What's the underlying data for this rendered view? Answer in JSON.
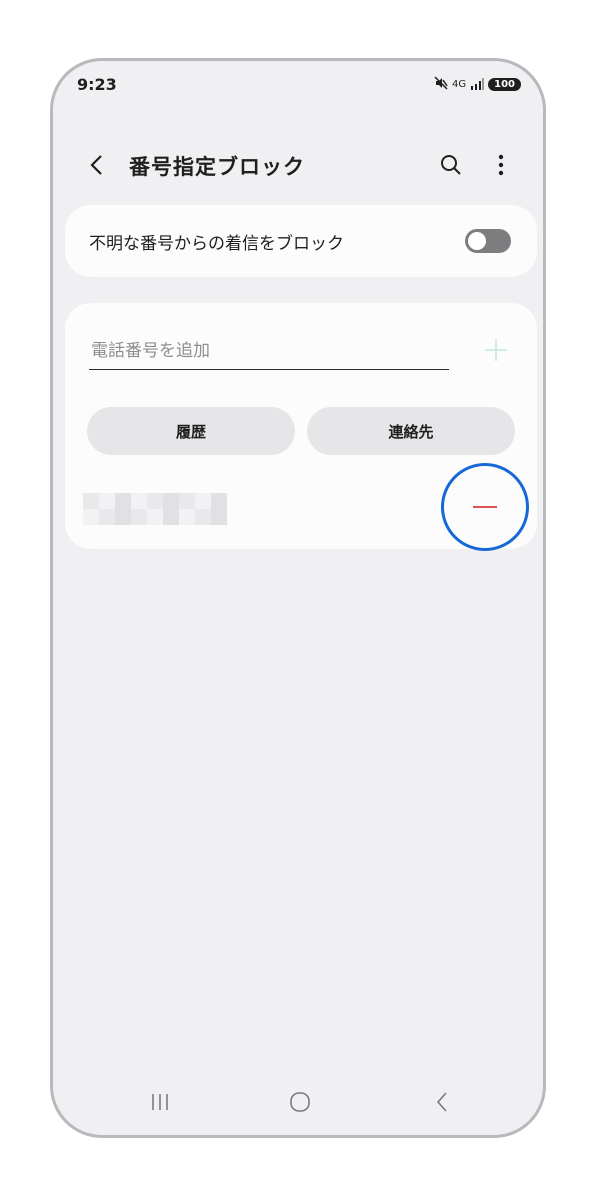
{
  "status_bar": {
    "time": "9:23",
    "network": "4G",
    "battery": "100",
    "icons": [
      "mute-icon",
      "network-4g-icon",
      "signal-icon",
      "battery-icon"
    ]
  },
  "header": {
    "title": "番号指定ブロック",
    "icons": [
      "back-arrow-icon",
      "search-icon",
      "more-vertical-icon"
    ]
  },
  "block_unknown": {
    "label": "不明な番号からの着信をブロック",
    "enabled": false
  },
  "add_number": {
    "placeholder": "電話番号を追加",
    "value": ""
  },
  "buttons": {
    "history": "履歴",
    "contacts": "連絡先"
  },
  "blocked_list": {
    "items": [
      {
        "number": ""
      }
    ]
  },
  "colors": {
    "background": "#f0f0f3",
    "card": "#fcfcfd",
    "accent_add": "#bfe6d8",
    "remove_red": "#d9534f",
    "highlight_blue": "#1668d6"
  }
}
